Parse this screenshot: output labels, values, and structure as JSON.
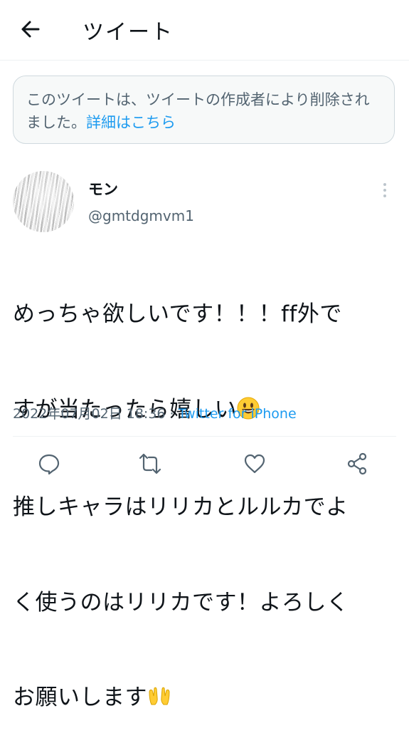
{
  "header": {
    "title": "ツイート",
    "back_icon": "arrow-left-icon"
  },
  "notice": {
    "text": "このツイートは、ツイートの作成者により削除されました。",
    "link": "詳細はこちら"
  },
  "tweet": {
    "author_name": "モン",
    "author_handle": "@gmtdgmvm1",
    "lines": [
      "めっちゃ欲しいです！！！ff外で",
      "すが当たったら嬉しい",
      "推しキャラはリリカとルルカでよ",
      "く使うのはリリカです！よろしく",
      "お願いします"
    ],
    "emojis": [
      "grinning-face-emoji",
      "palms-up-together-emoji"
    ],
    "timestamp": "2022年07月02日 18:36",
    "separator": " · ",
    "source": "Twitter for iPhone"
  },
  "actions": [
    "reply-icon",
    "retweet-icon",
    "like-icon",
    "share-icon"
  ],
  "colors": {
    "accent": "#1d9bf0",
    "text": "#0f1419",
    "muted": "#536471",
    "notice_bg": "#f7f9f9",
    "border": "#cfd9de"
  }
}
